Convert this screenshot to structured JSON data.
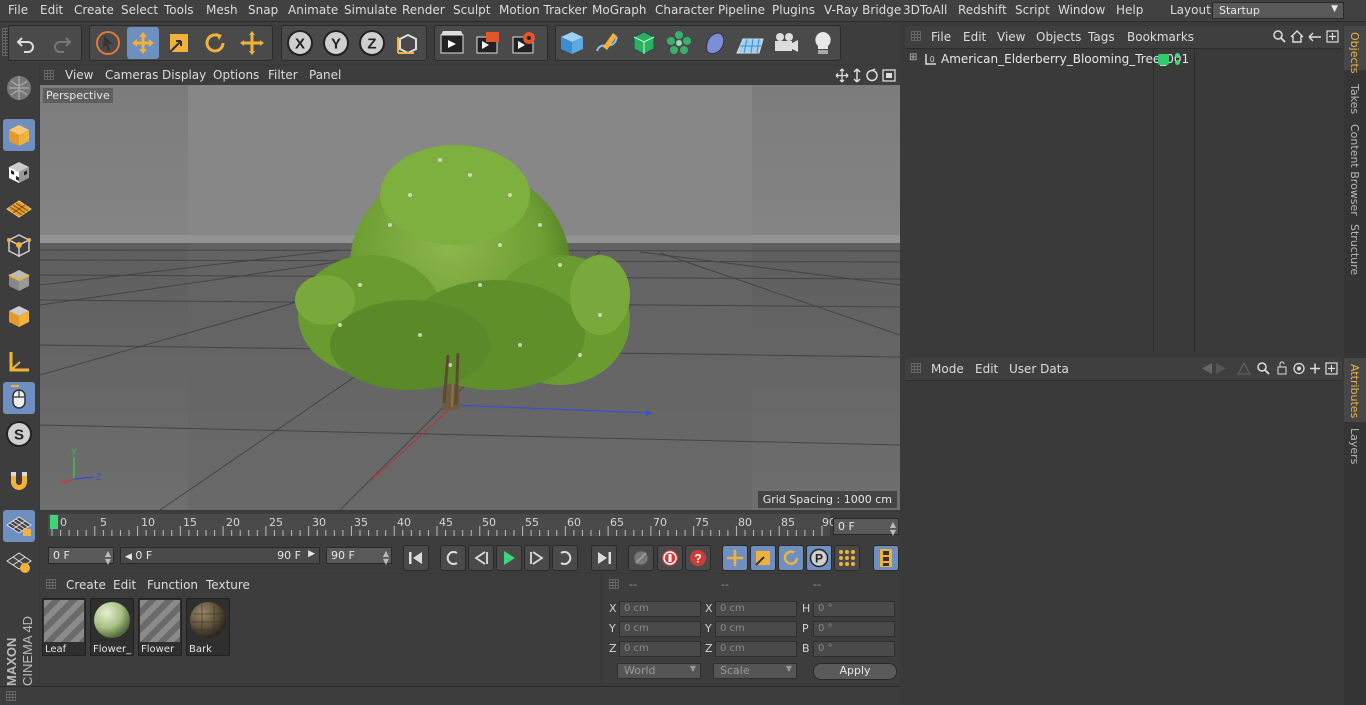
{
  "menu": {
    "items": [
      "File",
      "Edit",
      "Create",
      "Select",
      "Tools",
      "Mesh",
      "Snap",
      "Animate",
      "Simulate",
      "Render",
      "Sculpt",
      "Motion Tracker",
      "MoGraph",
      "Character",
      "Pipeline",
      "Plugins",
      "V-Ray Bridge",
      "3DToAll",
      "Redshift",
      "Script",
      "Window",
      "Help"
    ],
    "layout_label": "Layout:",
    "layout_value": "Startup"
  },
  "toolbar": {
    "icons": [
      "undo-icon",
      "redo-icon",
      "select-arrow-icon",
      "move-icon",
      "scale-icon",
      "rotate-icon",
      "live-select-icon",
      "x-axis-icon",
      "y-axis-icon",
      "z-axis-icon",
      "coordinate-system-icon",
      "render-view-icon",
      "render-picture-icon",
      "render-settings-icon",
      "cube-icon",
      "pen-icon",
      "subdivision-icon",
      "cloner-icon",
      "deformer-icon",
      "floor-icon",
      "camera-icon",
      "light-icon"
    ]
  },
  "viewport": {
    "menu": [
      "View",
      "Cameras",
      "Display",
      "Options",
      "Filter",
      "Panel"
    ],
    "label": "Perspective",
    "grid_spacing": "Grid Spacing : 1000 cm",
    "axis_labels": {
      "y": "Y",
      "x": "X",
      "z": "Z"
    }
  },
  "timeline": {
    "ticks": [
      "0",
      "5",
      "10",
      "15",
      "20",
      "25",
      "30",
      "35",
      "40",
      "45",
      "50",
      "55",
      "60",
      "65",
      "70",
      "75",
      "80",
      "85",
      "90"
    ],
    "current_frame": "0 F"
  },
  "transport": {
    "start_field": "0 F",
    "range_start": "0 F",
    "range_end": "90 F",
    "end_field": "90 F"
  },
  "materials": {
    "menu": [
      "Create",
      "Edit",
      "Function",
      "Texture"
    ],
    "items": [
      {
        "name": "Leaf",
        "type": "striped"
      },
      {
        "name": "Flower_",
        "type": "sphere-light"
      },
      {
        "name": "Flower",
        "type": "striped"
      },
      {
        "name": "Bark",
        "type": "sphere-dark"
      }
    ]
  },
  "coordinates": {
    "headers": [
      "--",
      "--",
      "--"
    ],
    "rows": [
      {
        "l1": "X",
        "v1": "0 cm",
        "l2": "X",
        "v2": "0 cm",
        "l3": "H",
        "v3": "0 °"
      },
      {
        "l1": "Y",
        "v1": "0 cm",
        "l2": "Y",
        "v2": "0 cm",
        "l3": "P",
        "v3": "0 °"
      },
      {
        "l1": "Z",
        "v1": "0 cm",
        "l2": "Z",
        "v2": "0 cm",
        "l3": "B",
        "v3": "0 °"
      }
    ],
    "space": "World",
    "mode": "Scale",
    "apply": "Apply"
  },
  "objects": {
    "menu": [
      "File",
      "Edit",
      "View",
      "Objects",
      "Tags",
      "Bookmarks"
    ],
    "tree": [
      {
        "name": "American_Elderberry_Blooming_Tree_001",
        "tag_color": "#2ecc71"
      }
    ]
  },
  "attributes": {
    "menu": [
      "Mode",
      "Edit",
      "User Data"
    ]
  },
  "side_tabs": {
    "top": [
      "Objects",
      "Takes",
      "Content Browser",
      "Structure"
    ],
    "bottom": [
      "Attributes",
      "Layers"
    ]
  },
  "brand": {
    "line1": "MAXON",
    "line2": "CINEMA 4D"
  },
  "colors": {
    "accent": "#f0b23b",
    "selected": "#6e8fbf",
    "panel": "#3d3d3d"
  }
}
